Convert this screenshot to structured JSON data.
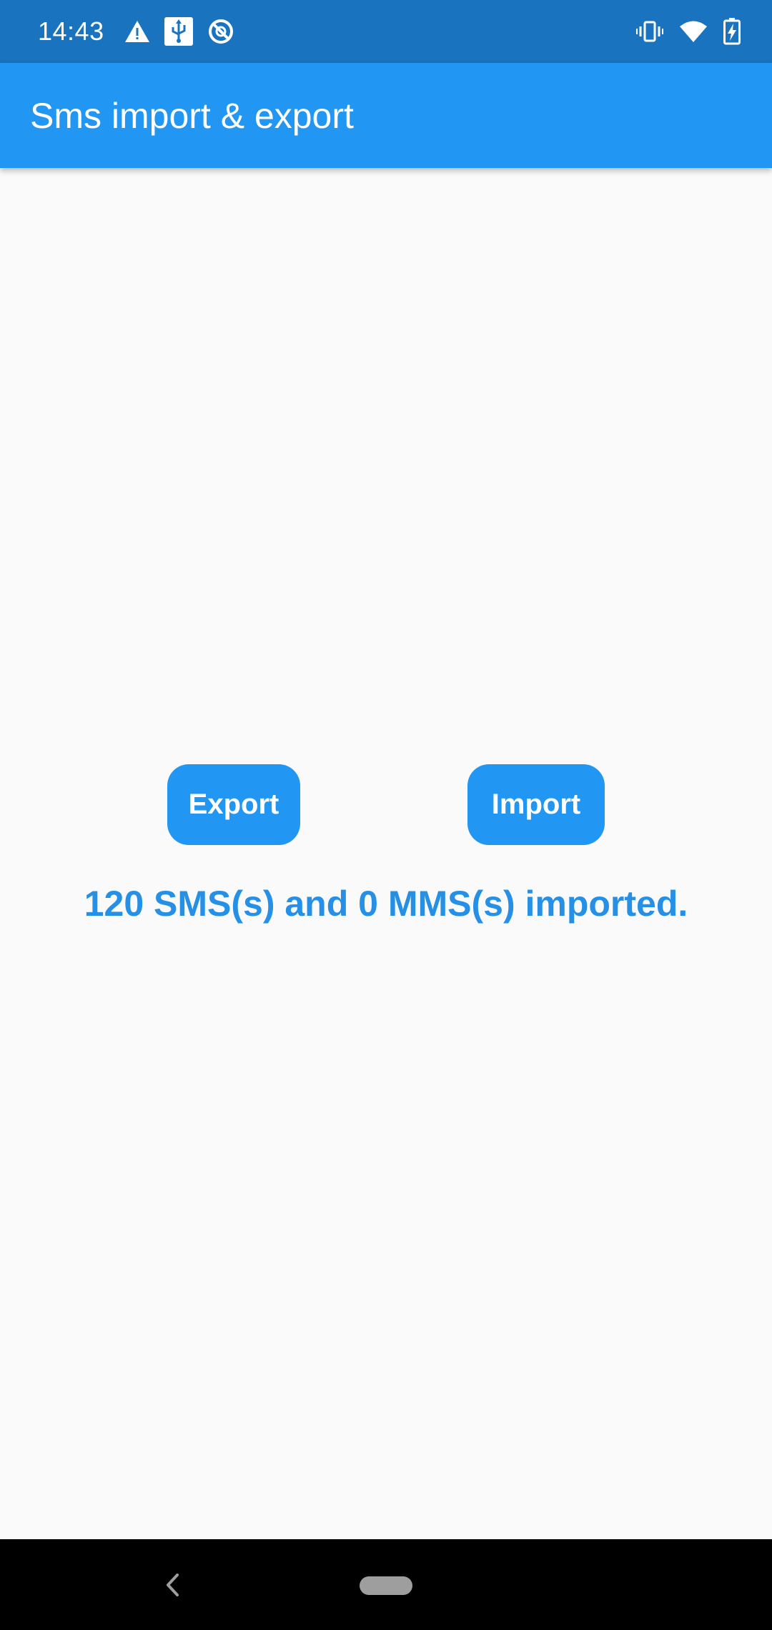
{
  "status_bar": {
    "time": "14:43",
    "left_icons": [
      "warning-icon",
      "usb-icon",
      "sync-disabled-icon"
    ],
    "right_icons": [
      "vibrate-icon",
      "wifi-icon",
      "battery-charging-icon"
    ],
    "background": "#1A73BE"
  },
  "app_bar": {
    "title": "Sms import & export",
    "background": "#2196F3"
  },
  "main": {
    "export_label": "Export",
    "import_label": "Import",
    "result_message": "120 SMS(s) and 0 MMS(s) imported.",
    "accent": "#2196F3",
    "result_color": "#2590E6"
  },
  "nav_bar": {
    "icons": [
      "back-icon",
      "home-pill-icon"
    ]
  }
}
